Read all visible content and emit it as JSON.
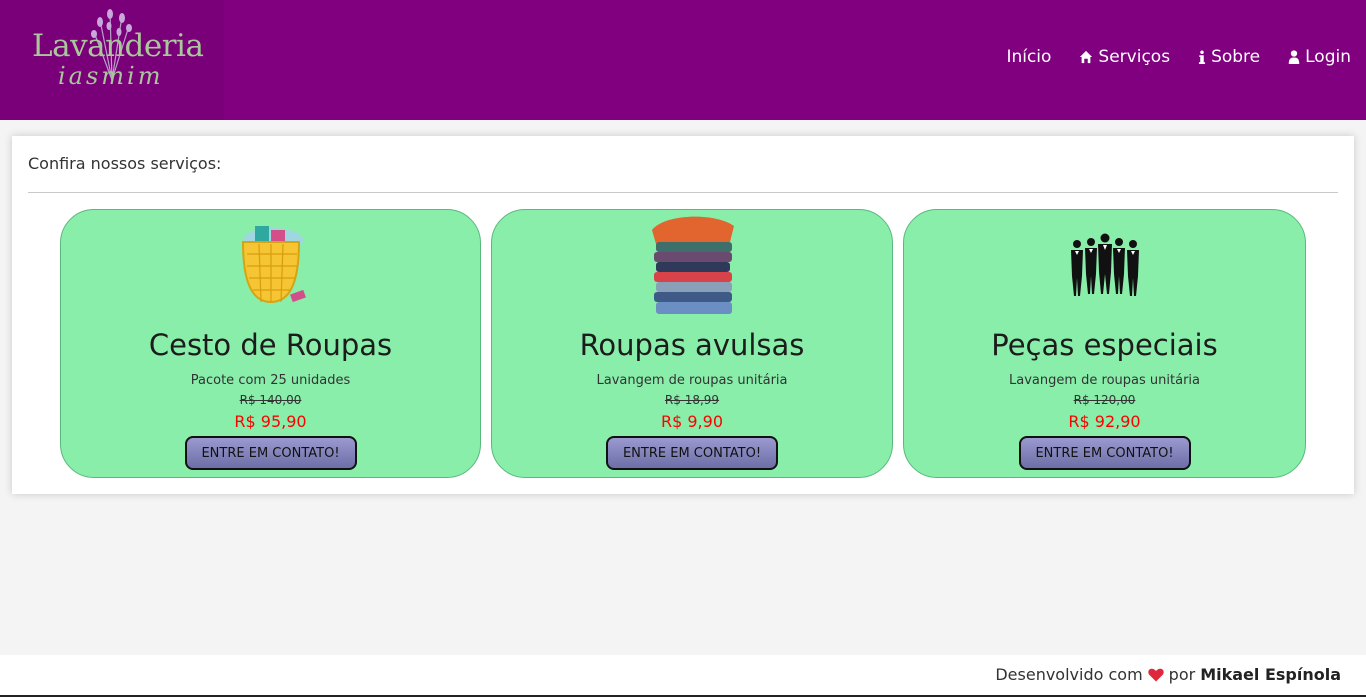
{
  "brand": {
    "name": "Lavanderia",
    "tagline": "iasmim"
  },
  "nav": [
    {
      "label": "Início",
      "icon": ""
    },
    {
      "label": "Serviços",
      "icon": "home-icon"
    },
    {
      "label": "Sobre",
      "icon": "info-icon"
    },
    {
      "label": "Login",
      "icon": "user-icon"
    }
  ],
  "services": {
    "heading": "Confira nossos serviços:",
    "cards": [
      {
        "title": "Cesto de Roupas",
        "description": "Pacote com 25 unidades",
        "old_price": "R$ 140,00",
        "price": "R$ 95,90",
        "button": "ENTRE EM CONTATO!",
        "image": "laundry-basket-image"
      },
      {
        "title": "Roupas avulsas",
        "description": "Lavangem de roupas unitária",
        "old_price": "R$ 18,99",
        "price": "R$ 9,90",
        "button": "ENTRE EM CONTATO!",
        "image": "folded-clothes-stack-image"
      },
      {
        "title": "Peças especiais",
        "description": "Lavangem de roupas unitária",
        "old_price": "R$ 120,00",
        "price": "R$ 92,90",
        "button": "ENTRE EM CONTATO!",
        "image": "suits-silhouette-image"
      }
    ]
  },
  "footer": {
    "prefix": "Desenvolvido com",
    "middle": "por",
    "author": "Mikael Espínola"
  },
  "colors": {
    "header": "#800080",
    "card": "#88eeaa",
    "price": "#ff0000",
    "heart": "#e0283c"
  }
}
